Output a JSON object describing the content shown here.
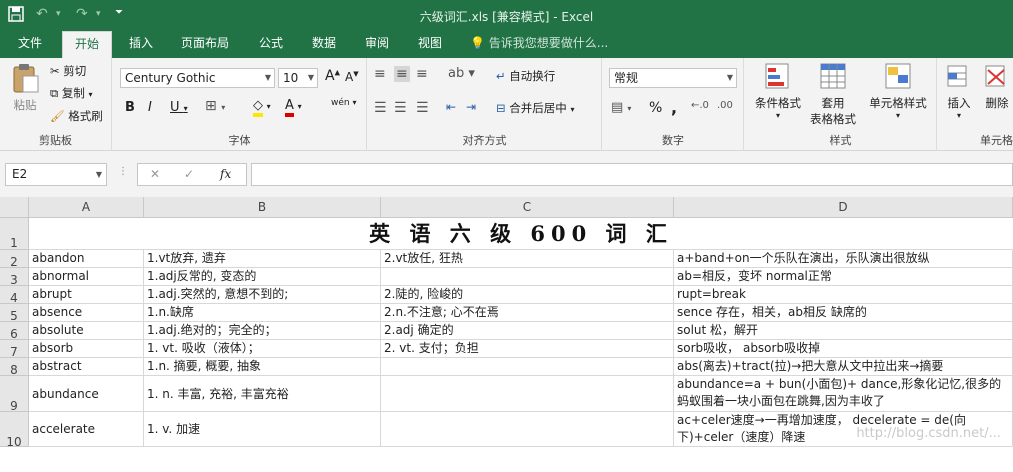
{
  "window": {
    "title": "六级词汇.xls  [兼容模式] - Excel"
  },
  "tabs": [
    "文件",
    "开始",
    "插入",
    "页面布局",
    "公式",
    "数据",
    "审阅",
    "视图"
  ],
  "tellme": "告诉我您想要做什么...",
  "ribbon": {
    "clipboard": {
      "paste": "粘贴",
      "cut": "剪切",
      "copy": "复制",
      "format_painter": "格式刷",
      "label": "剪贴板"
    },
    "font": {
      "name": "Century Gothic",
      "size": "10",
      "label": "字体",
      "bold": "B",
      "italic": "I",
      "underline": "U",
      "grow": "A",
      "shrink": "A",
      "phonetic": "wén"
    },
    "alignment": {
      "wrap": "自动换行",
      "merge": "合并后居中",
      "label": "对齐方式"
    },
    "number": {
      "format": "常规",
      "percent": "%",
      "comma": ",",
      "label": "数字"
    },
    "styles": {
      "conditional": "条件格式",
      "table1": "套用",
      "table2": "表格格式",
      "cell_styles": "单元格样式",
      "label": "样式"
    },
    "cells": {
      "insert": "插入",
      "delete": "删除",
      "label": "单元格"
    }
  },
  "formula_bar": {
    "name_box": "E2",
    "fx": "fx",
    "cancel": "✕",
    "enter": "✓",
    "value": ""
  },
  "columns": [
    "A",
    "B",
    "C",
    "D"
  ],
  "rows": [
    "1",
    "2",
    "3",
    "4",
    "5",
    "6",
    "7",
    "8",
    "9",
    "10"
  ],
  "sheet_title": "英 语 六 级 600 词 汇",
  "table": [
    [
      "abandon",
      "1.vt放弃, 遗弃",
      "2.vt放任, 狂热",
      "a+band+on一个乐队在演出，乐队演出很放纵"
    ],
    [
      "abnormal",
      "1.adj反常的, 变态的",
      "",
      "ab=相反，变坏 normal正常"
    ],
    [
      "abrupt",
      "1.adj.突然的, 意想不到的;",
      "2.陡的, 险峻的",
      "rupt=break"
    ],
    [
      "absence",
      "1.n.缺席",
      "2.n.不注意; 心不在焉",
      "sence 存在，相关，ab相反 缺席的"
    ],
    [
      "absolute",
      "1.adj.绝对的；完全的；",
      "2.adj 确定的",
      "solut 松，解开"
    ],
    [
      "absorb",
      "1. vt. 吸收（液体）；",
      "2. vt. 支付；负担",
      "sorb吸收， absorb吸收掉"
    ],
    [
      "abstract",
      "1.n. 摘要, 概要, 抽象",
      "",
      "abs(离去)+tract(拉)→把大意从文中拉出来→摘要"
    ],
    [
      "abundance",
      "1. n. 丰富, 充裕, 丰富充裕",
      "",
      "abundance=a + bun(小面包)+ dance,形象化记忆,很多的蚂蚁围着一块小面包在跳舞,因为丰收了"
    ],
    [
      "accelerate",
      "1. v. 加速",
      "",
      "ac+celer速度→一再增加速度， decelerate = de(向下)+celer（速度）降速"
    ]
  ],
  "watermark": "http://blog.csdn.net/..."
}
